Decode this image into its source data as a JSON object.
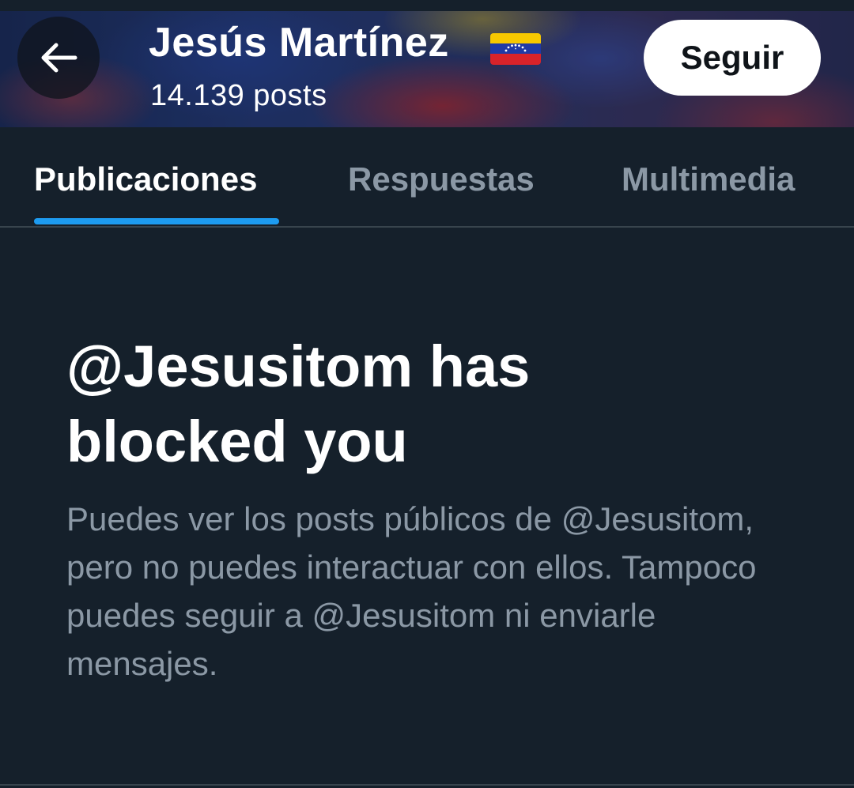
{
  "header": {
    "name": "Jesús Martínez",
    "post_count": "14.139 posts",
    "follow_label": "Seguir",
    "back_icon": "arrow-left-icon",
    "flag_icon": "venezuela-flag-icon"
  },
  "tabs": [
    {
      "label": "Publicaciones",
      "active": true
    },
    {
      "label": "Respuestas",
      "active": false
    },
    {
      "label": "Multimedia",
      "active": false
    }
  ],
  "blocked": {
    "title": "@Jesusitom has blocked you",
    "description": "Puedes ver los posts públicos de @Jesusitom, pero no puedes interactuar con ellos. Tampoco puedes seguir a @Jesusitom ni enviarle mensajes."
  },
  "colors": {
    "background": "#15202b",
    "accent": "#1d9bf0",
    "muted_text": "#8b98a5",
    "divider": "#38444d"
  }
}
